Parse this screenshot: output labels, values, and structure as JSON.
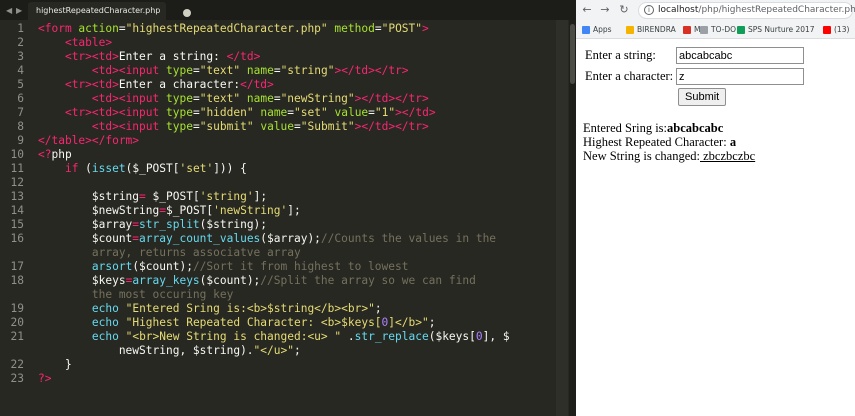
{
  "editor": {
    "tab_title": "highestRepeatedCharacter.php",
    "line_numbers": [
      "1",
      "2",
      "3",
      "4",
      "5",
      "6",
      "7",
      "8",
      "9",
      "10",
      "11",
      "12",
      "13",
      "14",
      "15",
      "16",
      "",
      "17",
      "18",
      "",
      "19",
      "20",
      "21",
      "",
      "22",
      "23"
    ],
    "code_lines": [
      [
        [
          "t-tag",
          "<form "
        ],
        [
          "t-attr",
          "action"
        ],
        [
          "t-txt",
          "="
        ],
        [
          "t-str",
          "\"highestRepeatedCharacter.php\""
        ],
        [
          "t-txt",
          " "
        ],
        [
          "t-attr",
          "method"
        ],
        [
          "t-txt",
          "="
        ],
        [
          "t-str",
          "\"POST\""
        ],
        [
          "t-tag",
          ">"
        ]
      ],
      [
        [
          "t-txt",
          "    "
        ],
        [
          "t-tag",
          "<table>"
        ]
      ],
      [
        [
          "t-txt",
          "    "
        ],
        [
          "t-tag",
          "<tr><td>"
        ],
        [
          "t-txt",
          "Enter a string: "
        ],
        [
          "t-tag",
          "</td>"
        ]
      ],
      [
        [
          "t-txt",
          "        "
        ],
        [
          "t-tag",
          "<td><input "
        ],
        [
          "t-attr",
          "type"
        ],
        [
          "t-txt",
          "="
        ],
        [
          "t-str",
          "\"text\""
        ],
        [
          "t-txt",
          " "
        ],
        [
          "t-attr",
          "name"
        ],
        [
          "t-txt",
          "="
        ],
        [
          "t-str",
          "\"string\""
        ],
        [
          "t-tag",
          "></td></tr>"
        ]
      ],
      [
        [
          "t-txt",
          "    "
        ],
        [
          "t-tag",
          "<tr><td>"
        ],
        [
          "t-txt",
          "Enter a character:"
        ],
        [
          "t-tag",
          "</td>"
        ]
      ],
      [
        [
          "t-txt",
          "        "
        ],
        [
          "t-tag",
          "<td><input "
        ],
        [
          "t-attr",
          "type"
        ],
        [
          "t-txt",
          "="
        ],
        [
          "t-str",
          "\"text\""
        ],
        [
          "t-txt",
          " "
        ],
        [
          "t-attr",
          "name"
        ],
        [
          "t-txt",
          "="
        ],
        [
          "t-str",
          "\"newString\""
        ],
        [
          "t-tag",
          "></td></tr>"
        ]
      ],
      [
        [
          "t-txt",
          "    "
        ],
        [
          "t-tag",
          "<tr><td><input "
        ],
        [
          "t-attr",
          "type"
        ],
        [
          "t-txt",
          "="
        ],
        [
          "t-str",
          "\"hidden\""
        ],
        [
          "t-txt",
          " "
        ],
        [
          "t-attr",
          "name"
        ],
        [
          "t-txt",
          "="
        ],
        [
          "t-str",
          "\"set\""
        ],
        [
          "t-txt",
          " "
        ],
        [
          "t-attr",
          "value"
        ],
        [
          "t-txt",
          "="
        ],
        [
          "t-str",
          "\"1\""
        ],
        [
          "t-tag",
          "></td>"
        ]
      ],
      [
        [
          "t-txt",
          "        "
        ],
        [
          "t-tag",
          "<td><input "
        ],
        [
          "t-attr",
          "type"
        ],
        [
          "t-txt",
          "="
        ],
        [
          "t-str",
          "\"submit\""
        ],
        [
          "t-txt",
          " "
        ],
        [
          "t-attr",
          "value"
        ],
        [
          "t-txt",
          "="
        ],
        [
          "t-str",
          "\"Submit\""
        ],
        [
          "t-tag",
          "></td></tr>"
        ]
      ],
      [
        [
          "t-tag",
          "</table></form>"
        ]
      ],
      [
        [
          "t-tag",
          "<?"
        ],
        [
          "t-txt",
          "php"
        ]
      ],
      [
        [
          "t-txt",
          "    "
        ],
        [
          "t-kw",
          "if"
        ],
        [
          "t-txt",
          " ("
        ],
        [
          "t-fn",
          "isset"
        ],
        [
          "t-txt",
          "($_POST["
        ],
        [
          "t-str",
          "'set'"
        ],
        [
          "t-txt",
          "])) {"
        ]
      ],
      [
        [
          "t-txt",
          ""
        ]
      ],
      [
        [
          "t-txt",
          "        $string"
        ],
        [
          "t-kw",
          "="
        ],
        [
          "t-txt",
          " $_POST["
        ],
        [
          "t-str",
          "'string'"
        ],
        [
          "t-txt",
          "];"
        ]
      ],
      [
        [
          "t-txt",
          "        $newString"
        ],
        [
          "t-kw",
          "="
        ],
        [
          "t-txt",
          "$_POST["
        ],
        [
          "t-str",
          "'newString'"
        ],
        [
          "t-txt",
          "];"
        ]
      ],
      [
        [
          "t-txt",
          "        $array"
        ],
        [
          "t-kw",
          "="
        ],
        [
          "t-fn",
          "str_split"
        ],
        [
          "t-txt",
          "($string);"
        ]
      ],
      [
        [
          "t-txt",
          "        $count"
        ],
        [
          "t-kw",
          "="
        ],
        [
          "t-fn",
          "array_count_values"
        ],
        [
          "t-txt",
          "($array);"
        ],
        [
          "t-com",
          "//Counts the values in the"
        ]
      ],
      [
        [
          "t-com",
          "        array, returns associatve array"
        ]
      ],
      [
        [
          "t-txt",
          "        "
        ],
        [
          "t-fn",
          "arsort"
        ],
        [
          "t-txt",
          "($count);"
        ],
        [
          "t-com",
          "//Sort it from highest to lowest"
        ]
      ],
      [
        [
          "t-txt",
          "        $keys"
        ],
        [
          "t-kw",
          "="
        ],
        [
          "t-fn",
          "array_keys"
        ],
        [
          "t-txt",
          "($count);"
        ],
        [
          "t-com",
          "//Split the array so we can find"
        ]
      ],
      [
        [
          "t-com",
          "        the most occuring key"
        ]
      ],
      [
        [
          "t-txt",
          "        "
        ],
        [
          "t-fn",
          "echo"
        ],
        [
          "t-txt",
          " "
        ],
        [
          "t-str",
          "\"Entered Sring is:<b>$string</b><br>\""
        ],
        [
          "t-txt",
          ";"
        ]
      ],
      [
        [
          "t-txt",
          "        "
        ],
        [
          "t-fn",
          "echo"
        ],
        [
          "t-txt",
          " "
        ],
        [
          "t-str",
          "\"Highest Repeated Character: <b>$keys["
        ],
        [
          "t-num",
          "0"
        ],
        [
          "t-str",
          "]</b>\""
        ],
        [
          "t-txt",
          ";"
        ]
      ],
      [
        [
          "t-txt",
          "        "
        ],
        [
          "t-fn",
          "echo"
        ],
        [
          "t-txt",
          " "
        ],
        [
          "t-str",
          "\"<br>New String is changed:<u> \""
        ],
        [
          "t-txt",
          " ."
        ],
        [
          "t-fn",
          "str_replace"
        ],
        [
          "t-txt",
          "($keys["
        ],
        [
          "t-num",
          "0"
        ],
        [
          "t-txt",
          "], $"
        ]
      ],
      [
        [
          "t-txt",
          "            newString, $string)."
        ],
        [
          "t-str",
          "\"</u>\""
        ],
        [
          "t-txt",
          ";"
        ]
      ],
      [
        [
          "t-txt",
          "    }"
        ]
      ],
      [
        [
          "t-tag",
          "?>"
        ]
      ]
    ]
  },
  "browser": {
    "nav": {
      "back": "←",
      "forward": "→",
      "reload": "↻"
    },
    "info_icon": "i",
    "url_host": "localhost",
    "url_path": "/php/highestRepeatedCharacter.php",
    "bookmarks": [
      {
        "label": "Apps",
        "icon": "apps-grid-icon",
        "color": "#4285f4"
      },
      {
        "label": "BIRENDRA",
        "icon": "folder-icon",
        "color": "#f4b400"
      },
      {
        "label": "M",
        "icon": "gmail-icon",
        "color": "#d93025"
      },
      {
        "label": "TO-DO",
        "icon": "todo-icon",
        "color": "#9aa0a6"
      },
      {
        "label": "SPS Nurture 2017",
        "icon": "sheets-icon",
        "color": "#0f9d58"
      },
      {
        "label": "(13)",
        "icon": "youtube-icon",
        "color": "#ff0000"
      }
    ],
    "form": {
      "string_label": "Enter a string:",
      "string_value": "abcabcabc",
      "char_label": "Enter a character:",
      "char_value": "z",
      "submit_label": "Submit"
    },
    "output": {
      "entered_prefix": "Entered Sring is:",
      "entered_value": "abcabcabc",
      "highest_prefix": "Highest Repeated Character: ",
      "highest_value": "a",
      "changed_prefix": "New String is changed:",
      "changed_value": " zbczbczbc"
    }
  },
  "colors": {
    "editor_bg": "#272822",
    "tag": "#f92672",
    "attr": "#a6e22e",
    "string": "#e6db74",
    "function": "#66d9ef",
    "number": "#ae81ff",
    "comment": "#75715e"
  }
}
